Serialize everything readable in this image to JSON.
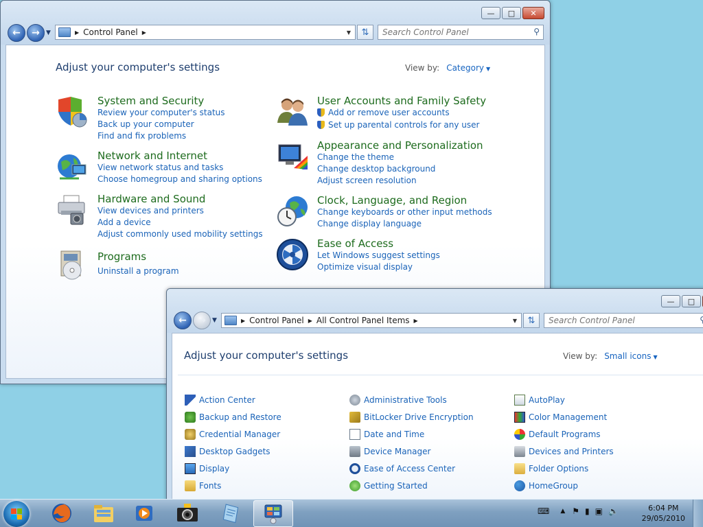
{
  "window1": {
    "breadcrumbs": [
      "Control Panel"
    ],
    "search_placeholder": "Search Control Panel",
    "heading": "Adjust your computer's settings",
    "view_by_label": "View by:",
    "view_by_value": "Category",
    "categories_left": [
      {
        "icon": "shield-system-icon",
        "title": "System and Security",
        "links": [
          "Review your computer's status",
          "Back up your computer",
          "Find and fix problems"
        ]
      },
      {
        "icon": "globe-network-icon",
        "title": "Network and Internet",
        "links": [
          "View network status and tasks",
          "Choose homegroup and sharing options"
        ]
      },
      {
        "icon": "printer-hardware-icon",
        "title": "Hardware and Sound",
        "links": [
          "View devices and printers",
          "Add a device",
          "Adjust commonly used mobility settings"
        ]
      },
      {
        "icon": "programs-disc-icon",
        "title": "Programs",
        "links": [
          "Uninstall a program"
        ]
      }
    ],
    "categories_right": [
      {
        "icon": "users-icon",
        "title": "User Accounts and Family Safety",
        "links": [
          "Add or remove user accounts",
          "Set up parental controls for any user"
        ]
      },
      {
        "icon": "monitor-palette-icon",
        "title": "Appearance and Personalization",
        "links": [
          "Change the theme",
          "Change desktop background",
          "Adjust screen resolution"
        ]
      },
      {
        "icon": "clock-globe-icon",
        "title": "Clock, Language, and Region",
        "links": [
          "Change keyboards or other input methods",
          "Change display language"
        ]
      },
      {
        "icon": "ease-of-access-icon",
        "title": "Ease of Access",
        "links": [
          "Let Windows suggest settings",
          "Optimize visual display"
        ]
      }
    ]
  },
  "window2": {
    "breadcrumbs": [
      "Control Panel",
      "All Control Panel Items"
    ],
    "search_placeholder": "Search Control Panel",
    "heading": "Adjust your computer's settings",
    "view_by_label": "View by:",
    "view_by_value": "Small icons",
    "col1": [
      "Action Center",
      "Backup and Restore",
      "Credential Manager",
      "Desktop Gadgets",
      "Display",
      "Fonts"
    ],
    "col2": [
      "Administrative Tools",
      "BitLocker Drive Encryption",
      "Date and Time",
      "Device Manager",
      "Ease of Access Center",
      "Getting Started"
    ],
    "col3": [
      "AutoPlay",
      "Color Management",
      "Default Programs",
      "Devices and Printers",
      "Folder Options",
      "HomeGroup"
    ]
  },
  "taskbar": {
    "apps": [
      "firefox-icon",
      "explorer-icon",
      "media-player-icon",
      "camera-icon",
      "notepad-icon",
      "control-panel-icon"
    ],
    "time": "6:04 PM",
    "date": "29/05/2010"
  },
  "colors": {
    "desktop": "#8fd0e6",
    "category_title": "#1d6b1d",
    "link": "#1a63b8"
  }
}
